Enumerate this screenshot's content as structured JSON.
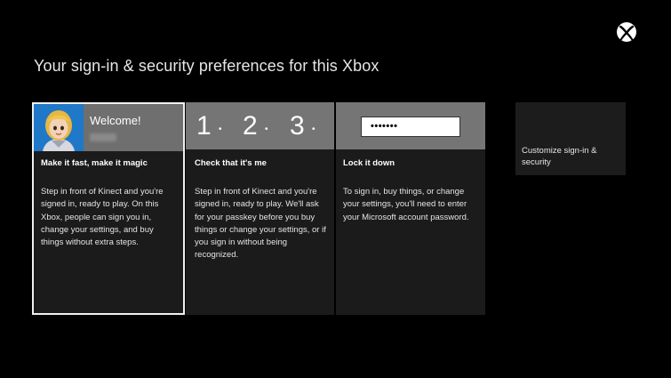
{
  "page": {
    "title": "Your sign-in & security preferences for this Xbox"
  },
  "logo": {
    "icon": "xbox-logo-icon"
  },
  "options": [
    {
      "welcome": "Welcome!",
      "title": "Make it fast, make it magic",
      "body": "Step in front of Kinect and you're signed in, ready to play. On this Xbox, people can sign you in, change your settings, and buy things without extra steps.",
      "selected": true
    },
    {
      "passkey_digits": [
        "1",
        "2",
        "3"
      ],
      "passkey_separator": "•",
      "title": "Check that it's me",
      "body": "Step in front of Kinect and you're signed in, ready to play. We'll ask for your passkey before you buy things or change your settings, or if you sign in without being recognized."
    },
    {
      "password_mask": "•••••••",
      "title": "Lock it down",
      "body": "To sign in, buy things, or change your settings, you'll need to enter your Microsoft account password."
    }
  ],
  "customize": {
    "label": "Customize sign-in & security"
  },
  "colors": {
    "background": "#000000",
    "card_background": "#1b1b1b",
    "header_gray": "#757575",
    "avatar_blue": "#1f78c8",
    "selected_border": "#f0f0f0"
  }
}
